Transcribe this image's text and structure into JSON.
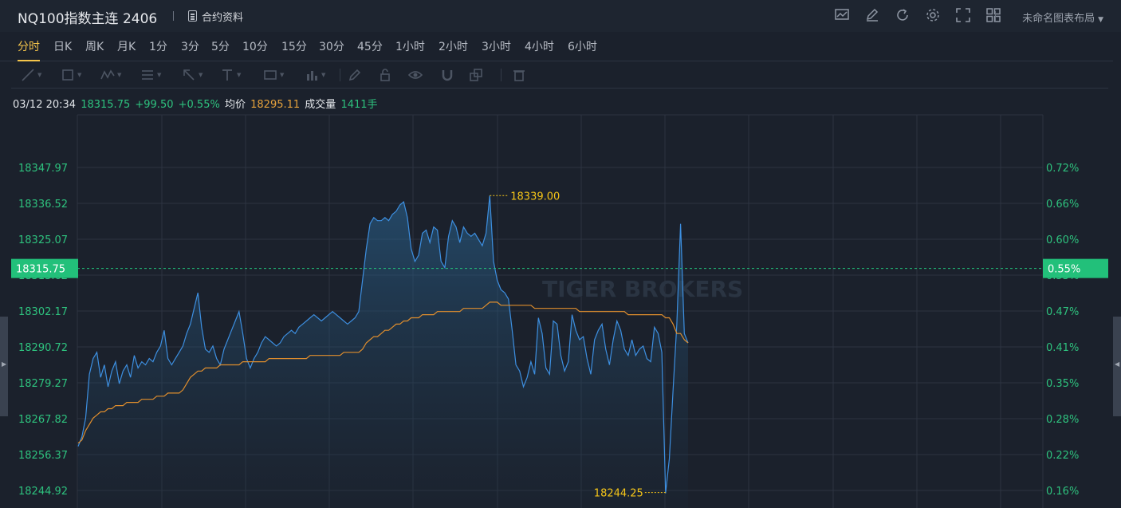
{
  "header": {
    "title": "NQ100指数主连 2406",
    "contract_info_label": "合约资料",
    "layout_label": "未命名图表布局",
    "icons": [
      "chart-settings-icon",
      "edit-icon",
      "refresh-icon",
      "gear-icon",
      "fullscreen-icon",
      "grid-layout-icon"
    ]
  },
  "tabs": [
    "分时",
    "日K",
    "周K",
    "月K",
    "1分",
    "3分",
    "5分",
    "10分",
    "15分",
    "30分",
    "45分",
    "1小时",
    "2小时",
    "3小时",
    "4小时",
    "6小时"
  ],
  "active_tab": "分时",
  "toolbar": {
    "tools": [
      "line-tool-icon",
      "rectangle-tool-icon",
      "wave-tool-icon",
      "fibonacci-tool-icon",
      "arrow-tool-icon",
      "text-tool-icon",
      "label-tool-icon",
      "measure-tool-icon",
      "pen-icon",
      "lock-icon",
      "eye-icon",
      "magnet-icon",
      "layers-icon",
      "trash-icon"
    ]
  },
  "info": {
    "datetime": "03/12 20:34",
    "price": "18315.75",
    "change": "+99.50",
    "change_pct": "+0.55%",
    "avg_label": "均价",
    "avg_price": "18295.11",
    "volume_label": "成交量",
    "volume": "1411手"
  },
  "colors": {
    "price_line": "#3d8fe0",
    "avg_line": "#e08e2d",
    "axis_text": "#2ec27e",
    "annotation": "#f5c518",
    "grid": "#2c3441",
    "current_badge": "#22c07a"
  },
  "watermark": "TIGER BROKERS",
  "chart_data": {
    "type": "line",
    "series": [
      {
        "name": "price",
        "values": [
          18259,
          18262,
          18268,
          18282,
          18287,
          18289,
          18281,
          18285,
          18278,
          18283,
          18286,
          18279,
          18283,
          18285,
          18281,
          18288,
          18284,
          18286,
          18285,
          18287,
          18286,
          18289,
          18291,
          18296,
          18287,
          18285,
          18287,
          18289,
          18291,
          18295,
          18298,
          18303,
          18308,
          18297,
          18290,
          18289,
          18291,
          18287,
          18285,
          18290,
          18293,
          18296,
          18299,
          18302,
          18295,
          18287,
          18284,
          18287,
          18289,
          18292,
          18294,
          18293,
          18292,
          18291,
          18292,
          18294,
          18295,
          18296,
          18295,
          18297,
          18298,
          18299,
          18300,
          18301,
          18300,
          18299,
          18300,
          18301,
          18302,
          18301,
          18300,
          18299,
          18298,
          18299,
          18300,
          18302,
          18312,
          18322,
          18330,
          18332,
          18331,
          18331,
          18332,
          18331,
          18333,
          18334,
          18336,
          18337,
          18332,
          18322,
          18318,
          18320,
          18327,
          18328,
          18324,
          18329,
          18328,
          18318,
          18316,
          18326,
          18331,
          18329,
          18324,
          18329,
          18327,
          18326,
          18327,
          18325,
          18323,
          18327,
          18339,
          18318,
          18312,
          18309,
          18308,
          18306,
          18296,
          18285,
          18283,
          18278,
          18281,
          18286,
          18282,
          18300,
          18295,
          18284,
          18282,
          18299,
          18298,
          18288,
          18283,
          18286,
          18301,
          18296,
          18293,
          18294,
          18287,
          18282,
          18293,
          18296,
          18298,
          18290,
          18285,
          18293,
          18299,
          18296,
          18290,
          18288,
          18293,
          18288,
          18290,
          18291,
          18287,
          18286,
          18297,
          18295,
          18289,
          18244,
          18255,
          18277,
          18298,
          18330,
          18295,
          18292
        ],
        "color": "#3d8fe0"
      },
      {
        "name": "avg",
        "values": [
          18260,
          18261,
          18264,
          18266,
          18268,
          18269,
          18270,
          18270,
          18271,
          18271,
          18272,
          18272,
          18272,
          18273,
          18273,
          18273,
          18273,
          18274,
          18274,
          18274,
          18274,
          18275,
          18275,
          18275,
          18276,
          18276,
          18276,
          18276,
          18277,
          18279,
          18281,
          18282,
          18283,
          18283,
          18284,
          18284,
          18284,
          18284,
          18285,
          18285,
          18285,
          18285,
          18285,
          18285,
          18286,
          18286,
          18286,
          18286,
          18286,
          18286,
          18286,
          18287,
          18287,
          18287,
          18287,
          18287,
          18287,
          18287,
          18287,
          18287,
          18287,
          18287,
          18288,
          18288,
          18288,
          18288,
          18288,
          18288,
          18288,
          18288,
          18288,
          18289,
          18289,
          18289,
          18289,
          18289,
          18290,
          18292,
          18293,
          18294,
          18294,
          18295,
          18296,
          18296,
          18297,
          18298,
          18298,
          18299,
          18299,
          18300,
          18300,
          18300,
          18301,
          18301,
          18301,
          18301,
          18302,
          18302,
          18302,
          18302,
          18302,
          18302,
          18302,
          18303,
          18303,
          18303,
          18303,
          18303,
          18303,
          18304,
          18305,
          18305,
          18305,
          18304,
          18304,
          18304,
          18304,
          18304,
          18304,
          18304,
          18304,
          18304,
          18303,
          18303,
          18303,
          18303,
          18303,
          18303,
          18303,
          18303,
          18303,
          18303,
          18303,
          18303,
          18302,
          18302,
          18302,
          18302,
          18302,
          18302,
          18302,
          18302,
          18302,
          18302,
          18302,
          18302,
          18302,
          18301,
          18301,
          18301,
          18301,
          18301,
          18301,
          18301,
          18301,
          18301,
          18301,
          18300,
          18300,
          18298,
          18295,
          18295,
          18293,
          18292
        ],
        "color": "#e08e2d"
      }
    ],
    "y_ticks": [
      "18347.97",
      "18336.52",
      "18325.07",
      "18313.62",
      "18302.17",
      "18290.72",
      "18279.27",
      "18267.82",
      "18256.37",
      "18244.92"
    ],
    "y_pct_ticks": [
      "0.72%",
      "0.66%",
      "0.60%",
      "0.53%",
      "0.47%",
      "0.41%",
      "0.35%",
      "0.28%",
      "0.22%",
      "0.16%"
    ],
    "ylim": [
      18244.92,
      18347.97
    ],
    "current_price": "18315.75",
    "current_pct": "0.55%",
    "high_label": "18339.00",
    "low_label": "18244.25",
    "high_value": 18339.0,
    "low_value": 18244.25,
    "grid": true
  }
}
